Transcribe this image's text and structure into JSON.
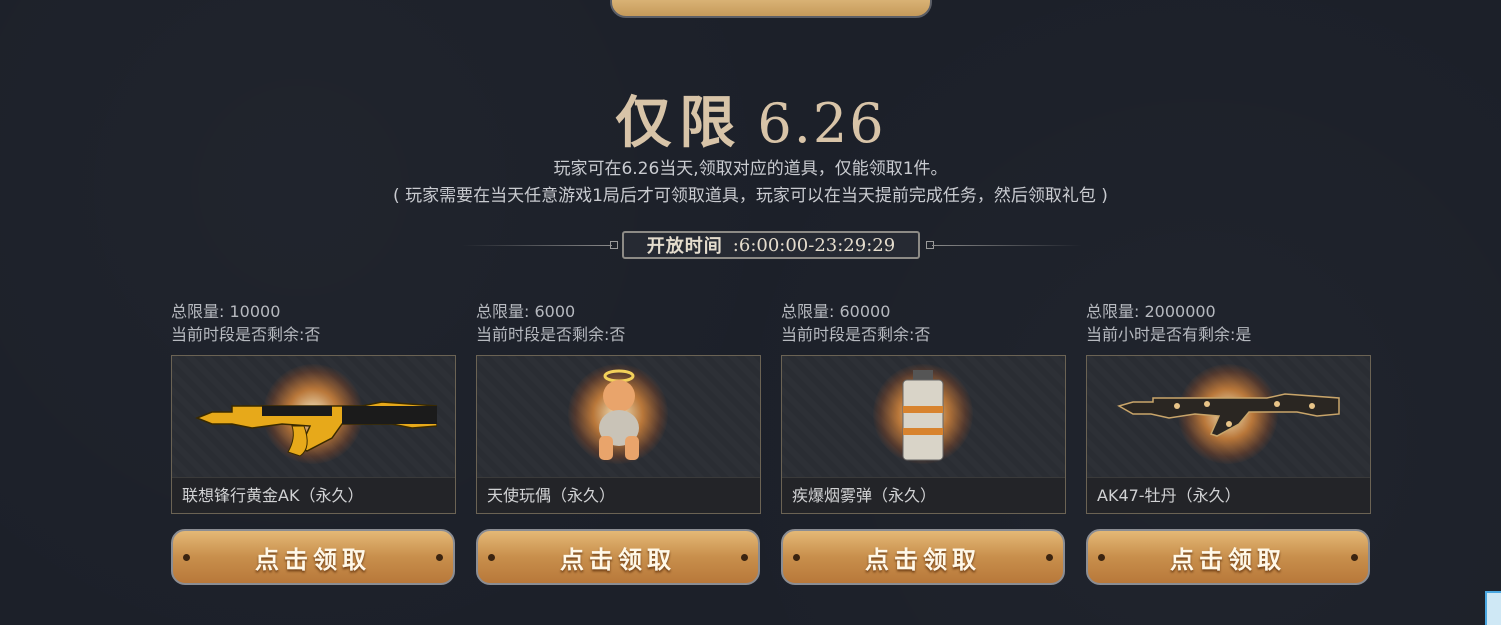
{
  "header": {
    "title_label": "仅限",
    "title_date": "6.26",
    "desc_line1": "玩家可在6.26当天,领取对应的道具，仅能领取1件。",
    "desc_line2": "( 玩家需要在当天任意游戏1局后才可领取道具，玩家可以在当天提前完成任务，然后领取礼包 )"
  },
  "open_time": {
    "label": "开放时间",
    "value": ":6:00:00-23:29:29"
  },
  "items": [
    {
      "limit_text": "总限量: 10000",
      "remain_text": "当前时段是否剩余:否",
      "name": "联想锋行黄金AK（永久）",
      "button": "点击领取",
      "icon": "golden-ak-rifle-icon"
    },
    {
      "limit_text": "总限量: 6000",
      "remain_text": "当前时段是否剩余:否",
      "name": "天使玩偶（永久）",
      "button": "点击领取",
      "icon": "angel-doll-icon"
    },
    {
      "limit_text": "总限量: 60000",
      "remain_text": "当前时段是否剩余:否",
      "name": "疾爆烟雾弹（永久）",
      "button": "点击领取",
      "icon": "smoke-grenade-icon"
    },
    {
      "limit_text": "总限量: 2000000",
      "remain_text": "当前小时是否有剩余:是",
      "name": "AK47-牡丹（永久）",
      "button": "点击领取",
      "icon": "peony-ak47-rifle-icon"
    }
  ],
  "colors": {
    "background": "#1c2029",
    "accent_gold": "#c88f4c",
    "title": "#d8c4a8"
  }
}
